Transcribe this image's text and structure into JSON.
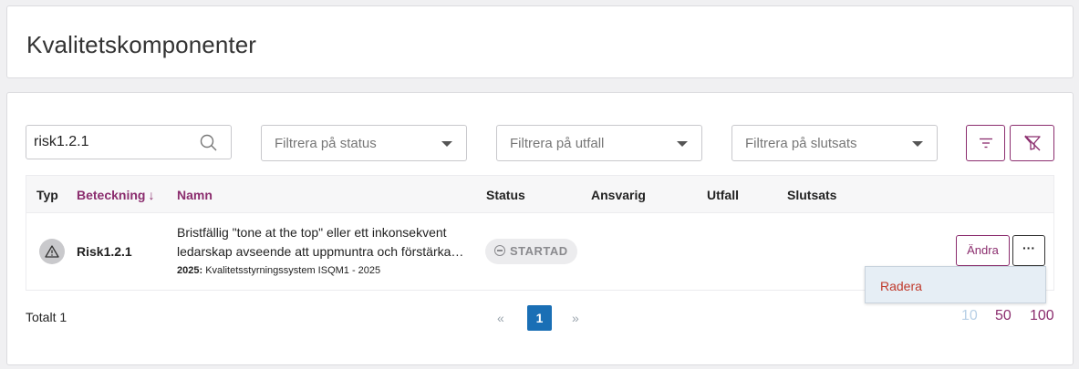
{
  "page": {
    "title": "Kvalitetskomponenter"
  },
  "search": {
    "value": "risk1.2.1"
  },
  "filters": {
    "status_placeholder": "Filtrera på status",
    "outcome_placeholder": "Filtrera på utfall",
    "conclusion_placeholder": "Filtrera på slutsats"
  },
  "table": {
    "columns": {
      "typ": "Typ",
      "beteckning": "Beteckning",
      "beteckning_sort": "↓",
      "namn": "Namn",
      "status": "Status",
      "ansvarig": "Ansvarig",
      "utfall": "Utfall",
      "slutsats": "Slutsats"
    },
    "rows": [
      {
        "type_icon": "warning-icon",
        "code": "Risk1.2.1",
        "name_line1": "Bristfällig \"tone at the top\" eller ett inkonsekvent",
        "name_line2": "ledarskap avseende att uppmuntra och förstärka…",
        "sub_bold": "2025:",
        "sub_text": " Kvalitetsstyrningssystem ISQM1 - 2025",
        "status": "STARTAD",
        "edit_label": "Ändra",
        "more_label": "···"
      }
    ]
  },
  "menu": {
    "delete_label": "Radera"
  },
  "footer": {
    "total": "Totalt 1",
    "prev": "«",
    "page": "1",
    "next": "»",
    "page_sizes": [
      "10",
      "50",
      "100"
    ]
  },
  "colors": {
    "accent": "#8b2d6e",
    "pager_active": "#1a6fb5",
    "danger": "#c0392b"
  }
}
